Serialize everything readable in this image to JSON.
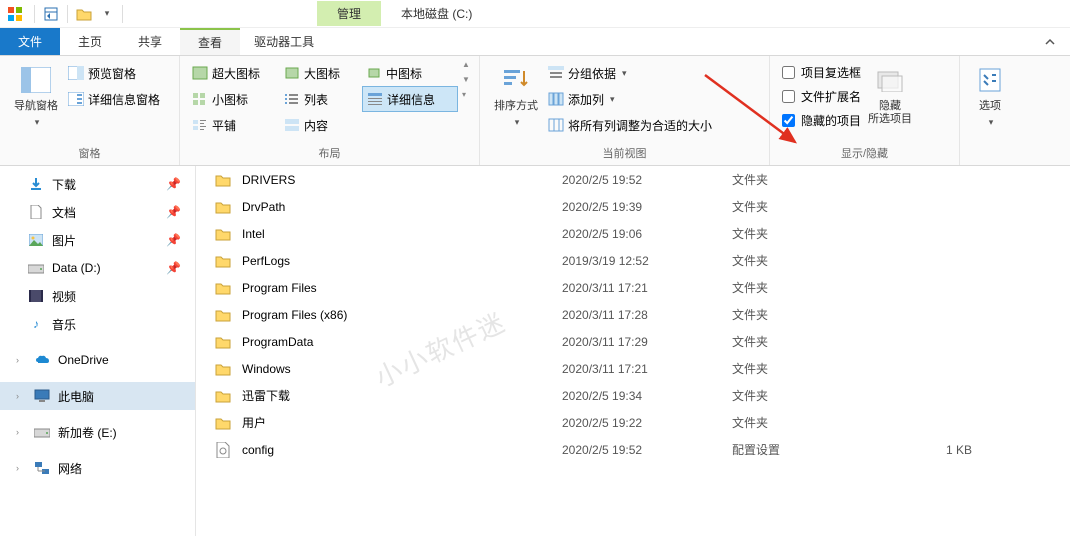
{
  "title": "本地磁盘 (C:)",
  "manage_tab": "管理",
  "tabs": {
    "file": "文件",
    "home": "主页",
    "share": "共享",
    "view": "查看",
    "drive_tools": "驱动器工具"
  },
  "ribbon": {
    "panes": {
      "label": "窗格",
      "nav_pane": "导航窗格",
      "preview": "预览窗格",
      "details": "详细信息窗格"
    },
    "layout": {
      "label": "布局",
      "xlarge": "超大图标",
      "large": "大图标",
      "medium": "中图标",
      "small": "小图标",
      "list": "列表",
      "details": "详细信息",
      "tiles": "平铺",
      "content": "内容"
    },
    "current_view": {
      "label": "当前视图",
      "sort": "排序方式",
      "group_by": "分组依据",
      "add_columns": "添加列",
      "autosize": "将所有列调整为合适的大小"
    },
    "show_hide": {
      "label": "显示/隐藏",
      "item_checkboxes": "项目复选框",
      "file_ext": "文件扩展名",
      "hidden_items": "隐藏的项目",
      "hide_selected": "隐藏\n所选项目"
    },
    "options": "选项"
  },
  "nav": {
    "downloads": "下载",
    "documents": "文档",
    "pictures": "图片",
    "data_d": "Data (D:)",
    "videos": "视频",
    "music": "音乐",
    "onedrive": "OneDrive",
    "this_pc": "此电脑",
    "new_volume_e": "新加卷 (E:)",
    "network": "网络"
  },
  "rows": [
    {
      "name": "DRIVERS",
      "date": "2020/2/5 19:52",
      "type": "文件夹",
      "size": ""
    },
    {
      "name": "DrvPath",
      "date": "2020/2/5 19:39",
      "type": "文件夹",
      "size": ""
    },
    {
      "name": "Intel",
      "date": "2020/2/5 19:06",
      "type": "文件夹",
      "size": ""
    },
    {
      "name": "PerfLogs",
      "date": "2019/3/19 12:52",
      "type": "文件夹",
      "size": ""
    },
    {
      "name": "Program Files",
      "date": "2020/3/11 17:21",
      "type": "文件夹",
      "size": ""
    },
    {
      "name": "Program Files (x86)",
      "date": "2020/3/11 17:28",
      "type": "文件夹",
      "size": ""
    },
    {
      "name": "ProgramData",
      "date": "2020/3/11 17:29",
      "type": "文件夹",
      "size": ""
    },
    {
      "name": "Windows",
      "date": "2020/3/11 17:21",
      "type": "文件夹",
      "size": ""
    },
    {
      "name": "迅雷下载",
      "date": "2020/2/5 19:34",
      "type": "文件夹",
      "size": ""
    },
    {
      "name": "用户",
      "date": "2020/2/5 19:22",
      "type": "文件夹",
      "size": ""
    },
    {
      "name": "config",
      "date": "2020/2/5 19:52",
      "type": "配置设置",
      "size": "1 KB"
    }
  ],
  "watermark": "小小软件迷"
}
